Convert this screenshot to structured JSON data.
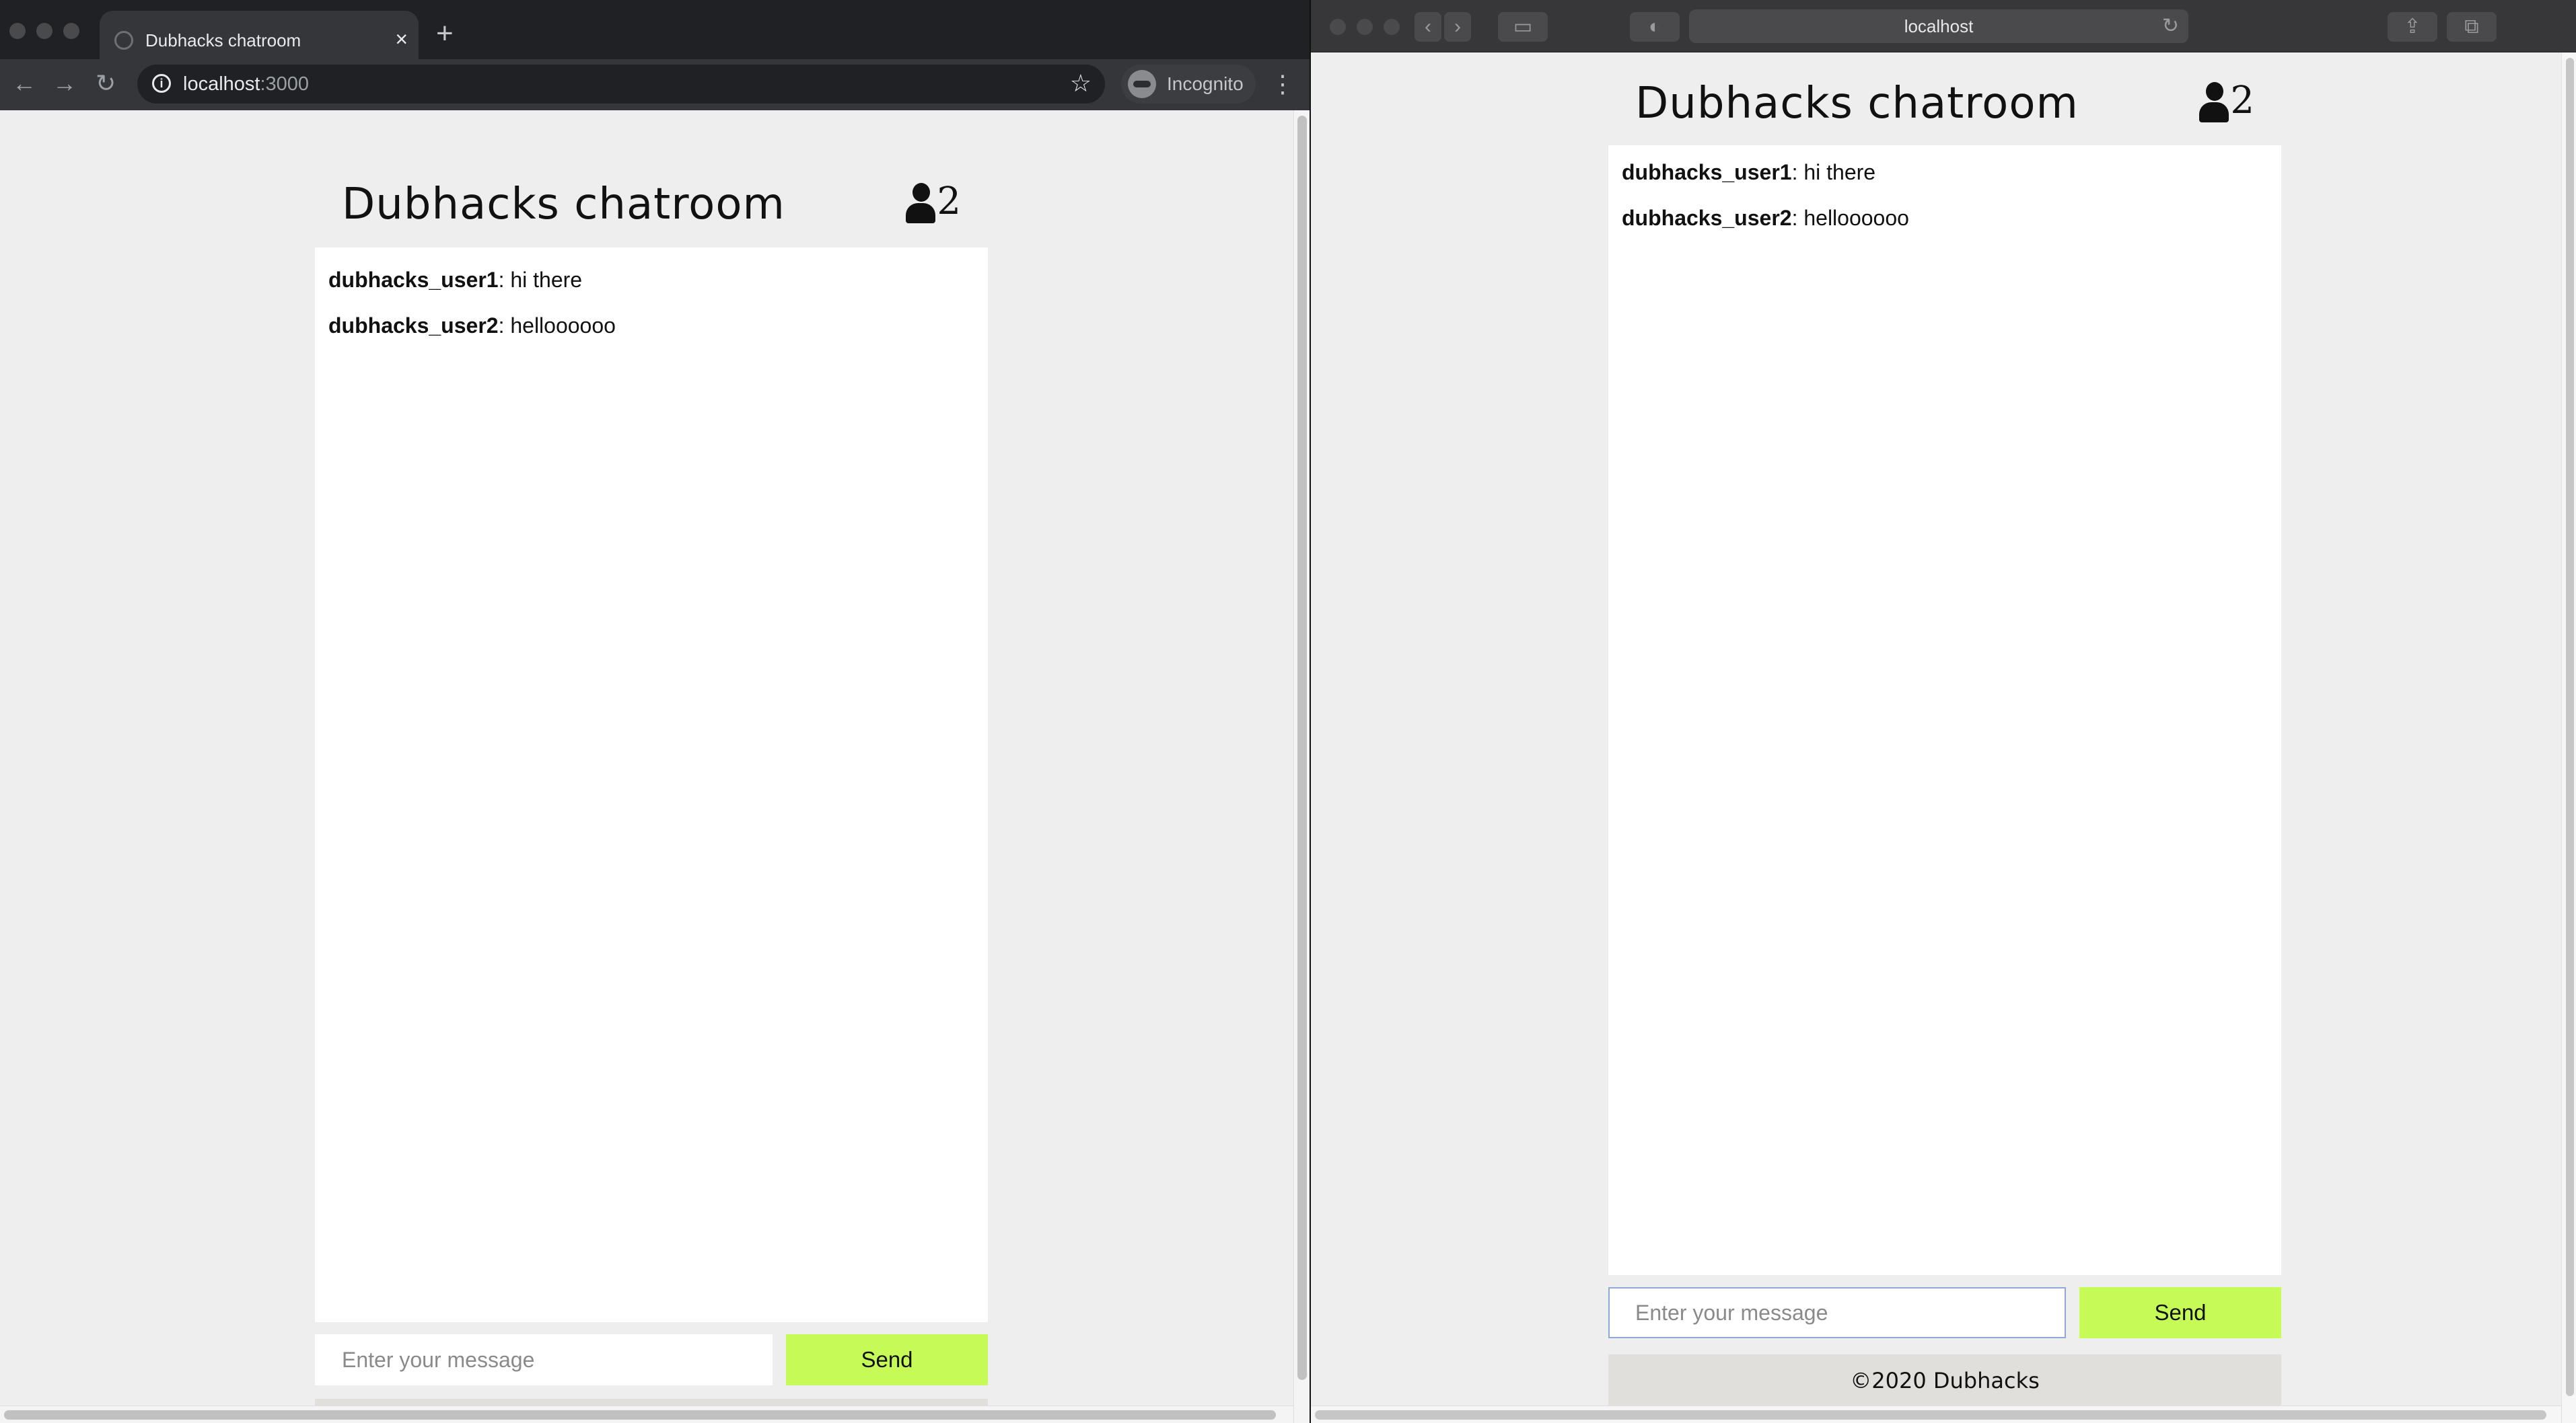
{
  "chrome": {
    "tab_title": "Dubhacks chatroom",
    "tab_close": "×",
    "new_tab": "+",
    "nav_back": "←",
    "nav_forward": "→",
    "nav_reload": "↻",
    "url_host": "localhost",
    "url_port": ":3000",
    "star": "☆",
    "incognito_label": "Incognito",
    "menu": "⋮"
  },
  "safari": {
    "back": "‹",
    "forward": "›",
    "sidebar": "▭",
    "privacy": "◐",
    "url": "localhost",
    "reload": "↻",
    "share": "⇪",
    "tabs": "⧉"
  },
  "chat": {
    "title": "Dubhacks chatroom",
    "user_count": "2",
    "messages": [
      {
        "user": "dubhacks_user1",
        "text": ": hi there"
      },
      {
        "user": "dubhacks_user2",
        "text": ": helloooooo"
      }
    ],
    "input_placeholder": "Enter your message",
    "send_label": "Send",
    "footer": "©2020 Dubhacks"
  },
  "colors": {
    "send_button": "#c6fb57",
    "footer_bg": "#e1dfdb",
    "page_bg": "#eeeeee"
  }
}
